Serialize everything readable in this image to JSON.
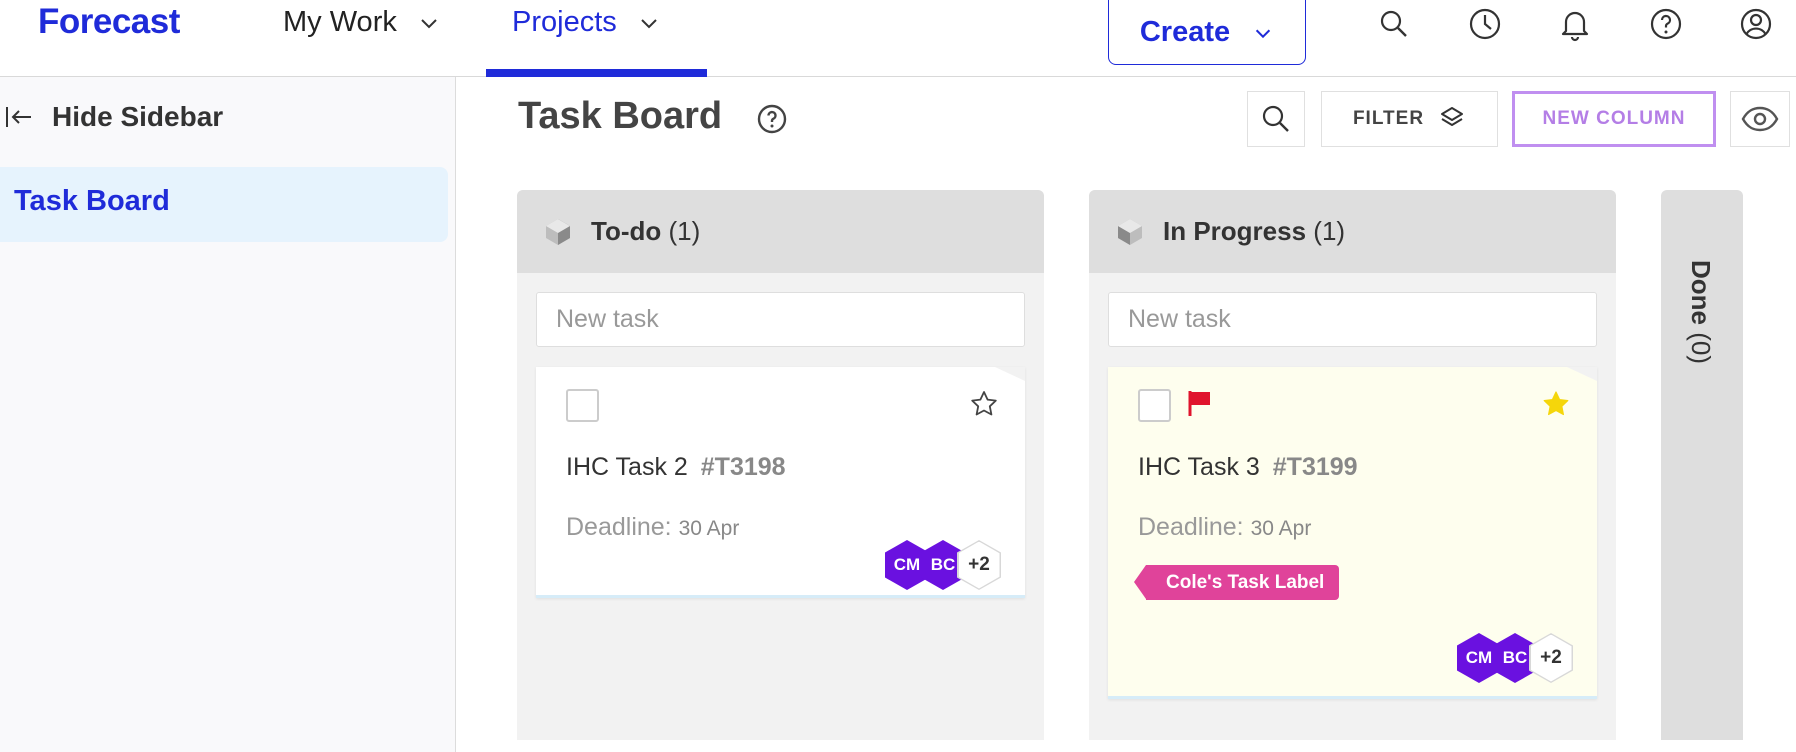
{
  "nav": {
    "logo": "Forecast",
    "my_work": "My Work",
    "projects": "Projects",
    "create": "Create",
    "icons": [
      "search-icon",
      "clock-icon",
      "bell-icon",
      "help-icon",
      "account-icon"
    ]
  },
  "sidebar": {
    "hide_label": "Hide Sidebar",
    "active_item": "Task Board"
  },
  "header": {
    "title": "Task Board",
    "filter_label": "FILTER",
    "new_column_label": "NEW COLUMN"
  },
  "columns": [
    {
      "name": "To-do",
      "count": "(1)",
      "new_task_placeholder": "New task",
      "card": {
        "title": "IHC Task 2",
        "id": "#T3198",
        "deadline_label": "Deadline:",
        "deadline_value": "30 Apr",
        "starred": false,
        "flagged": false,
        "assignees": [
          "CM",
          "BC"
        ],
        "more": "+2"
      }
    },
    {
      "name": "In Progress",
      "count": "(1)",
      "new_task_placeholder": "New task",
      "card": {
        "title": "IHC Task 3",
        "id": "#T3199",
        "deadline_label": "Deadline:",
        "deadline_value": "30 Apr",
        "starred": true,
        "flagged": true,
        "label": "Cole's Task Label",
        "assignees": [
          "CM",
          "BC"
        ],
        "more": "+2"
      }
    },
    {
      "name": "Done",
      "count": "(0)"
    }
  ],
  "colors": {
    "brand": "#1f2bd9",
    "label_pink": "#e0439a",
    "avatar_purple": "#6a11e0",
    "flag_red": "#e0142d",
    "star_yellow": "#f5d60b"
  }
}
